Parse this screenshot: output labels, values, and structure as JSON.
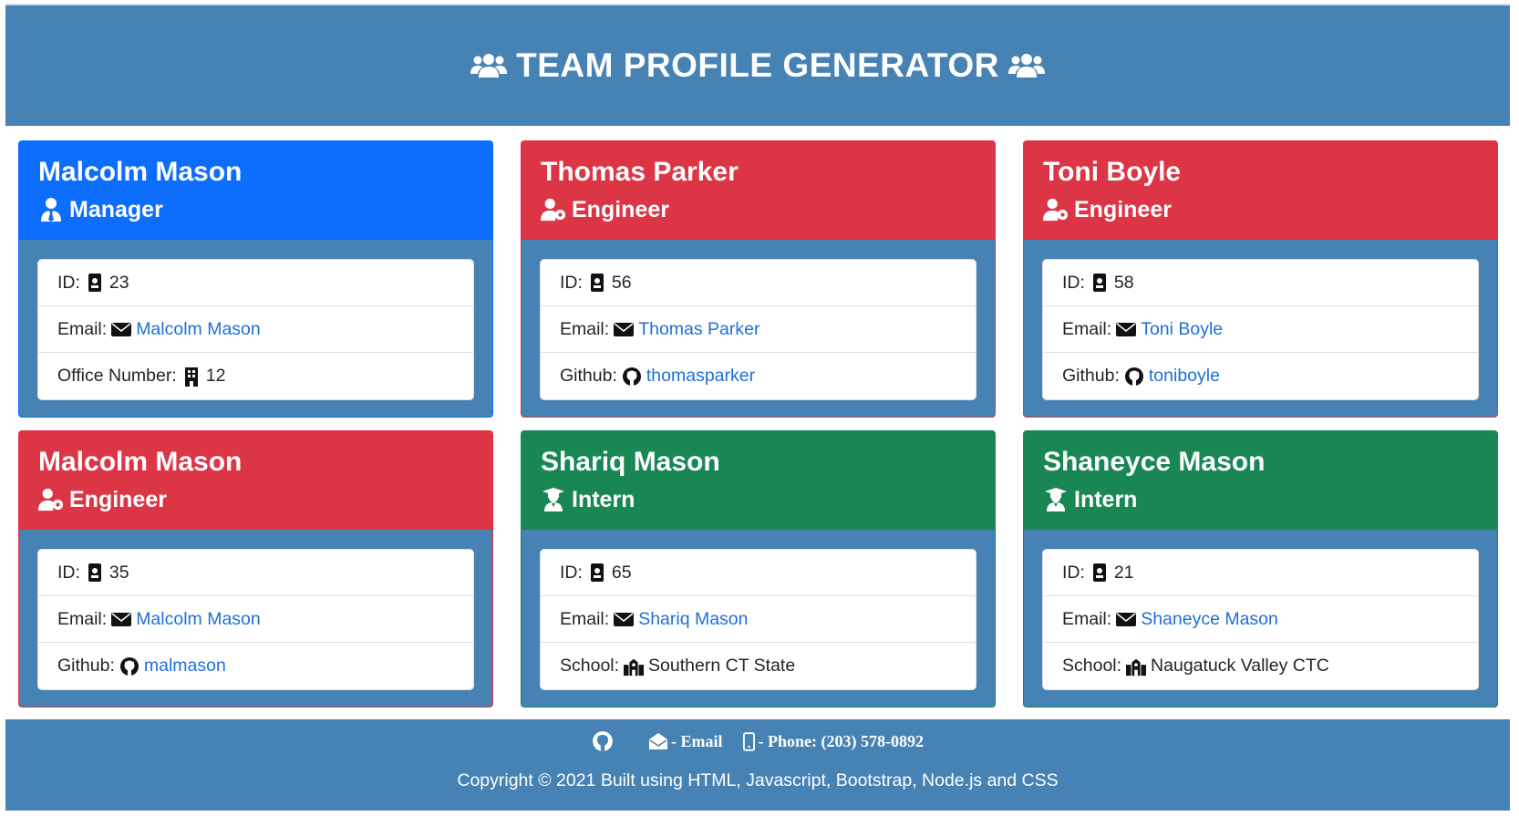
{
  "header": {
    "title": "TEAM PROFILE GENERATOR",
    "icon": "users-icon"
  },
  "labels": {
    "id": "ID:",
    "email": "Email:",
    "office": "Office Number:",
    "github": "Github:",
    "school": "School:"
  },
  "colors": {
    "header": "#4682b4",
    "manager": "#0d6efd",
    "engineer": "#dc3545",
    "intern": "#198754"
  },
  "team": [
    {
      "name": "Malcolm Mason",
      "role": "Manager",
      "id": "23",
      "email": "Malcolm Mason",
      "extra_label": "Office Number:",
      "extra_value": "12",
      "extra_icon": "building-icon"
    },
    {
      "name": "Thomas Parker",
      "role": "Engineer",
      "id": "56",
      "email": "Thomas Parker",
      "extra_label": "Github:",
      "extra_value": "thomasparker",
      "extra_icon": "github-icon"
    },
    {
      "name": "Toni Boyle",
      "role": "Engineer",
      "id": "58",
      "email": "Toni Boyle",
      "extra_label": "Github:",
      "extra_value": "toniboyle",
      "extra_icon": "github-icon"
    },
    {
      "name": "Malcolm Mason",
      "role": "Engineer",
      "id": "35",
      "email": "Malcolm Mason",
      "extra_label": "Github:",
      "extra_value": "malmason",
      "extra_icon": "github-icon"
    },
    {
      "name": "Shariq Mason",
      "role": "Intern",
      "id": "65",
      "email": "Shariq Mason",
      "extra_label": "School:",
      "extra_value": "Southern CT State",
      "extra_icon": "school-icon"
    },
    {
      "name": "Shaneyce Mason",
      "role": "Intern",
      "id": "21",
      "email": "Shaneyce Mason",
      "extra_label": "School:",
      "extra_value": "Naugatuck Valley CTC",
      "extra_icon": "school-icon"
    }
  ],
  "footer": {
    "email_label": "- Email",
    "phone_label": "- Phone: (203) 578-0892",
    "copyright": "Copyright © 2021 Built using HTML, Javascript, Bootstrap, Node.js and CSS"
  }
}
